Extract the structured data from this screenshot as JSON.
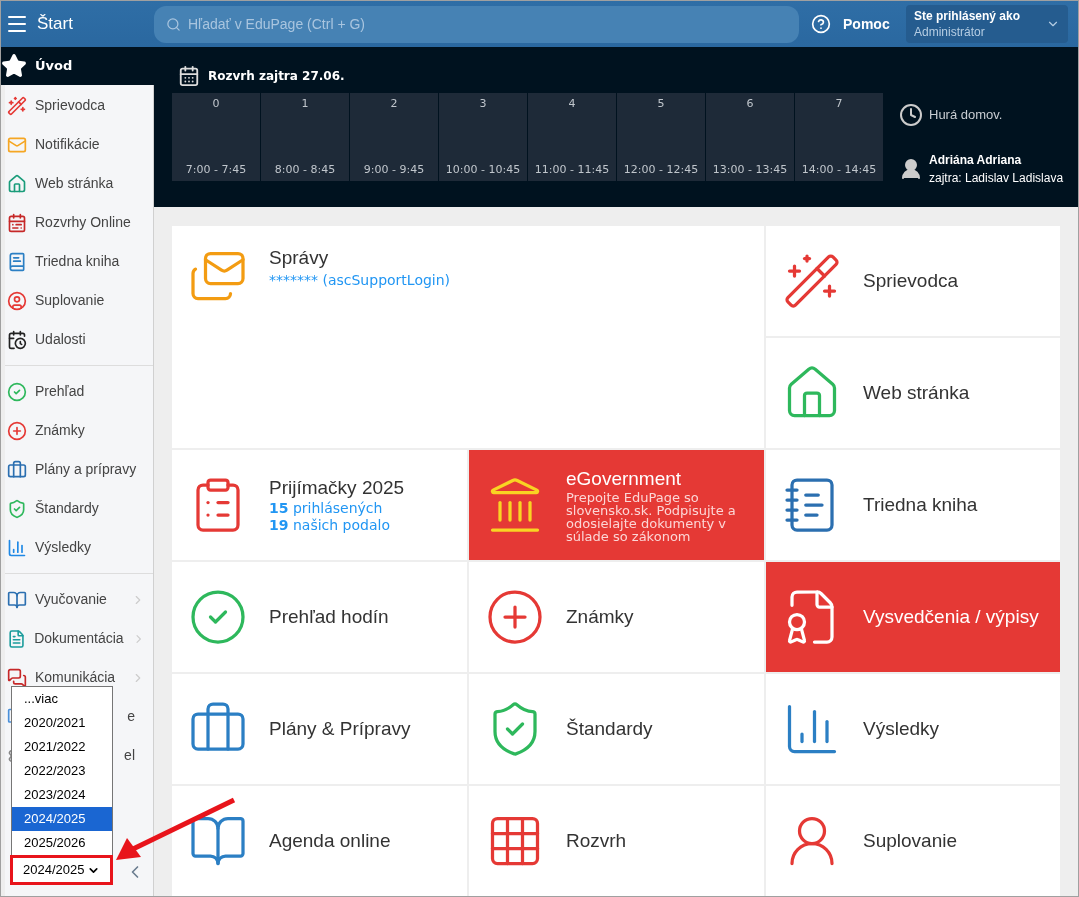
{
  "topbar": {
    "menu_title": "Štart",
    "search": {
      "placeholder": "Hľadať v EduPage (Ctrl + G)"
    },
    "help": "Pomoc",
    "user": {
      "label": "Ste prihlásený ako",
      "role": "Administrátor"
    }
  },
  "sidebar": {
    "current": {
      "label": "Úvod",
      "selected": true
    },
    "groups": [
      [
        {
          "label": "Sprievodca",
          "submenu": false
        },
        {
          "label": "Notifikácie",
          "submenu": false
        },
        {
          "label": "Web stránka",
          "submenu": false
        },
        {
          "label": "Rozvrhy Online",
          "submenu": false
        },
        {
          "label": "Triedna kniha",
          "submenu": false
        },
        {
          "label": "Suplovanie",
          "submenu": false
        },
        {
          "label": "Udalosti",
          "submenu": false
        }
      ],
      [
        {
          "label": "Prehľad",
          "submenu": false
        },
        {
          "label": "Známky",
          "submenu": false
        },
        {
          "label": "Plány a prípravy",
          "submenu": false
        },
        {
          "label": "Štandardy",
          "submenu": false
        },
        {
          "label": "Výsledky",
          "submenu": false
        }
      ],
      [
        {
          "label": "Vyučovanie",
          "submenu": true
        },
        {
          "label": "Dokumentácia",
          "submenu": true
        },
        {
          "label": "Komunikácia",
          "submenu": true
        },
        {
          "label": "e",
          "submenu": false
        },
        {
          "label": "el",
          "submenu": false
        }
      ]
    ],
    "year_select": {
      "value": "2024/2025",
      "options": [
        {
          "label": "...viac",
          "selected": false
        },
        {
          "label": "2020/2021",
          "selected": false
        },
        {
          "label": "2021/2022",
          "selected": false
        },
        {
          "label": "2022/2023",
          "selected": false
        },
        {
          "label": "2023/2024",
          "selected": false
        },
        {
          "label": "2024/2025",
          "selected": true
        },
        {
          "label": "2025/2026",
          "selected": false
        }
      ]
    }
  },
  "schedule": {
    "title": "Rozvrh zajtra 27.06.",
    "periods": [
      {
        "number": "0",
        "time": "7:00 - 7:45"
      },
      {
        "number": "1",
        "time": "8:00 - 8:45"
      },
      {
        "number": "2",
        "time": "9:00 - 9:45"
      },
      {
        "number": "3",
        "time": "10:00 - 10:45"
      },
      {
        "number": "4",
        "time": "11:00 - 11:45"
      },
      {
        "number": "5",
        "time": "12:00 - 12:45"
      },
      {
        "number": "6",
        "time": "13:00 - 13:45"
      },
      {
        "number": "7",
        "time": "14:00 - 14:45"
      }
    ],
    "status": "Hurá domov.",
    "teacher": "Adriána Adriana",
    "tomorrow": "zajtra: Ladislav Ladislava"
  },
  "tiles": [
    {
      "title": "Správy",
      "kind": "large",
      "highlighted": false,
      "lines": [
        "******* (ascSupportLogin)"
      ]
    },
    {
      "title": "Sprievodca",
      "kind": "normal",
      "highlighted": false
    },
    {
      "title": "Web stránka",
      "kind": "normal",
      "highlighted": false
    },
    {
      "title": "Prijímačky 2025",
      "kind": "normal",
      "highlighted": false,
      "lines": [
        "**15** prihlásených",
        "**19** našich podalo"
      ]
    },
    {
      "title": "eGovernment",
      "kind": "normal",
      "highlighted": true,
      "description": "Prepojte EduPage so slovensko.sk. Podpisujte a odosielajte dokumenty v súlade so zákonom"
    },
    {
      "title": "Triedna kniha",
      "kind": "normal",
      "highlighted": false
    },
    {
      "title": "Prehľad hodín",
      "kind": "normal",
      "highlighted": false
    },
    {
      "title": "Známky",
      "kind": "normal",
      "highlighted": false
    },
    {
      "title": "Vysvedčenia / výpisy",
      "kind": "normal",
      "highlighted": true
    },
    {
      "title": "Plány & Prípravy",
      "kind": "normal",
      "highlighted": false
    },
    {
      "title": "Štandardy",
      "kind": "normal",
      "highlighted": false
    },
    {
      "title": "Výsledky",
      "kind": "normal",
      "highlighted": false
    },
    {
      "title": "Agenda online",
      "kind": "normal",
      "highlighted": false
    },
    {
      "title": "Rozvrh",
      "kind": "normal",
      "highlighted": false
    },
    {
      "title": "Suplovanie",
      "kind": "normal",
      "highlighted": false
    }
  ]
}
